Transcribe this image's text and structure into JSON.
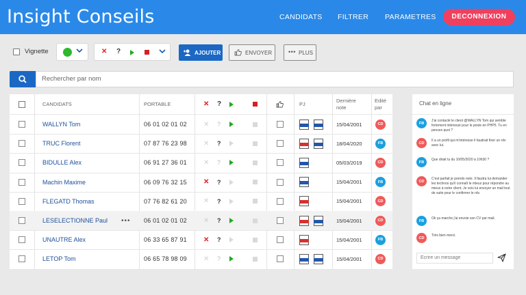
{
  "header": {
    "brand": "Insight Conseils",
    "nav": [
      "CANDIDATS",
      "FILTRER",
      "PARAMETRES"
    ],
    "logout": "DECONNEXION"
  },
  "toolbar": {
    "vignette_label": "Vignette",
    "status_color": "#2eb82e",
    "ajouter": "AJOUTER",
    "envoyer": "ENVOYER",
    "plus": "PLUS"
  },
  "search": {
    "placeholder": "Rechercher par nom"
  },
  "table": {
    "headers": {
      "candidats": "CANDIDATS",
      "portable": "PORTABLE",
      "pj": "PJ",
      "derniere_note_1": "Dernière",
      "derniere_note_2": "note",
      "edite_par_1": "Edité",
      "edite_par_2": "par"
    },
    "rows": [
      {
        "name": "WALLYN Tom",
        "phone": "06 01 02 01 02",
        "x": false,
        "q": false,
        "play": true,
        "stop": false,
        "files": [
          "doc",
          "doc"
        ],
        "date": "15/04/2001",
        "by": "CD"
      },
      {
        "name": "TRUC Florent",
        "phone": "07 87 76 23 98",
        "x": false,
        "q": true,
        "play": false,
        "stop": false,
        "files": [
          "pdf",
          "doc"
        ],
        "date": "18/04/2020",
        "by": "FB"
      },
      {
        "name": "BIDULLE Alex",
        "phone": "06 91 27 36 01",
        "x": false,
        "q": false,
        "play": true,
        "stop": false,
        "files": [
          "doc"
        ],
        "date": "05/03/2019",
        "by": "CD"
      },
      {
        "name": "Machin Maxime",
        "phone": "06 09 76 32 15",
        "x": true,
        "q": true,
        "play": false,
        "stop": false,
        "files": [
          "doc"
        ],
        "date": "15/04/2001",
        "by": "FB"
      },
      {
        "name": "FLEGATD Thomas",
        "phone": "07 76 82 61 20",
        "x": false,
        "q": true,
        "play": false,
        "stop": false,
        "files": [
          "pdf"
        ],
        "date": "15/04/2001",
        "by": "CD"
      },
      {
        "name": "LESELECTIONNE Paul",
        "phone": "06 01 02 01 02",
        "x": false,
        "q": true,
        "play": true,
        "stop": false,
        "files": [
          "pdf",
          "doc"
        ],
        "date": "15/04/2001",
        "by": "CD",
        "hl": true,
        "more": "•••"
      },
      {
        "name": "UNAUTRE Alex",
        "phone": "06 33 65 87 91",
        "x": true,
        "q": true,
        "play": false,
        "stop": false,
        "files": [
          "pdf"
        ],
        "date": "15/04/2001",
        "by": "FB"
      },
      {
        "name": "LETOP Tom",
        "phone": "06 65 78 98 09",
        "x": false,
        "q": false,
        "play": true,
        "stop": false,
        "files": [
          "doc",
          "doc"
        ],
        "date": "15/04/2001",
        "by": "CD"
      }
    ]
  },
  "chat": {
    "title": "Chat en ligne",
    "messages": [
      {
        "by": "FB",
        "text": "J'ai contacté le client @WALLYN Tom qui semble fortement intéressé pour le poste en PHP5. Tu en penses quoi ?"
      },
      {
        "by": "CD",
        "text": "Il a un profil qui m'intéresse il faudrait fixer un rdv avec lui."
      },
      {
        "by": "FB",
        "text": "Que dirait tu du 10/05/2020 à 10h30 ?"
      },
      {
        "by": "CD",
        "text": "C'est parfait je prends note. Il faudra lui demander les technos qu'il connaît le mieux pour répondre au mieux à notre client. Je vois lui envoyer un mail tout de suite pour le confirmer le rdv."
      },
      {
        "by": "FB",
        "text": "Ok ça marche j'ai envoie son CV par mail."
      },
      {
        "by": "CD",
        "text": "Très bien merci."
      }
    ],
    "input_placeholder": "Ecrire un message"
  }
}
